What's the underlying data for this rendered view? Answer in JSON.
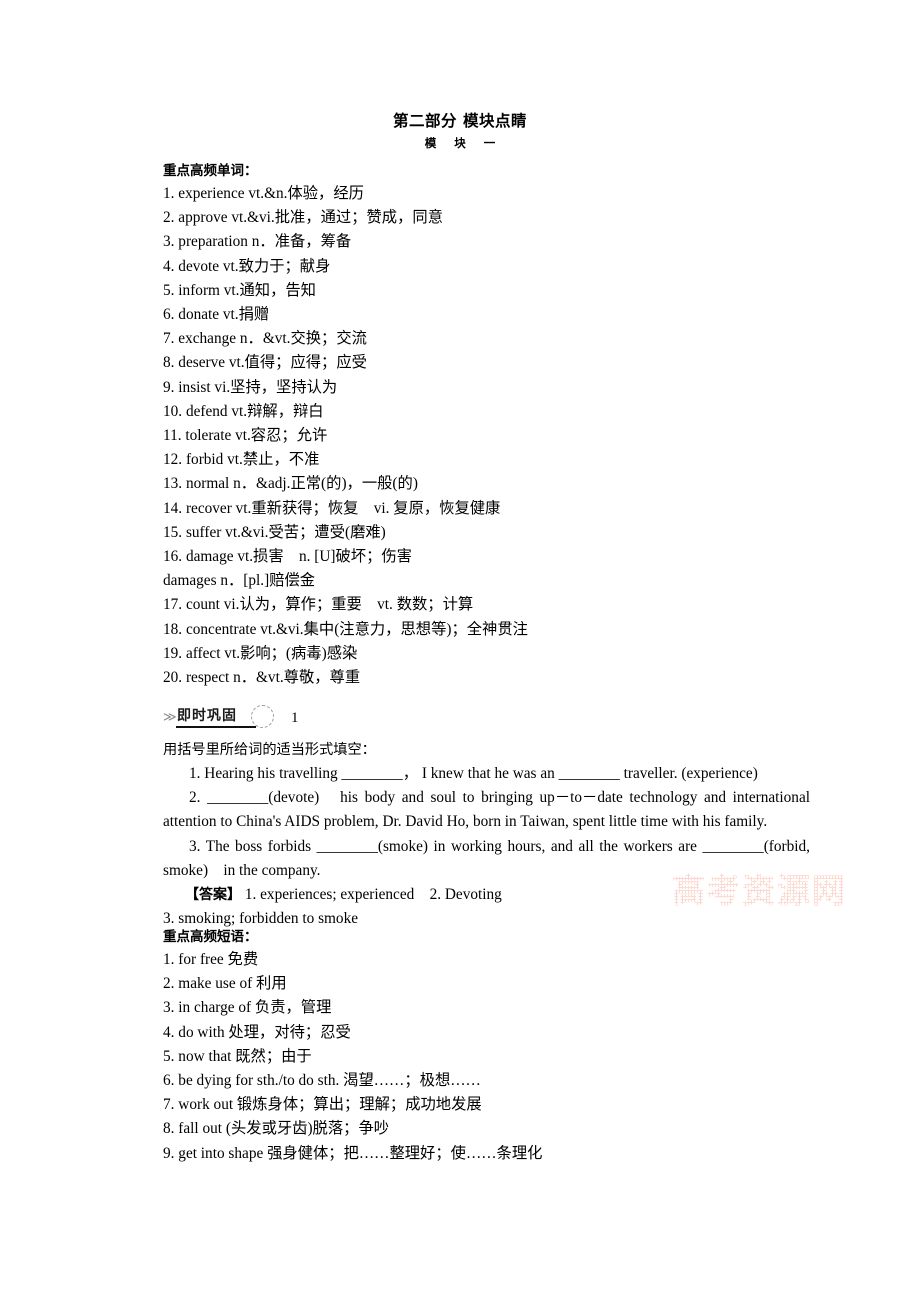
{
  "header": {
    "title": "第二部分  模块点睛",
    "subtitle": "模  块  一"
  },
  "words_section": {
    "heading": "重点高频单词：",
    "items": [
      "1. experience vt.&n.体验，经历",
      "2. approve vt.&vi.批准，通过；赞成，同意",
      "3. preparation n．准备，筹备",
      "4. devote vt.致力于；献身",
      "5. inform vt.通知，告知",
      "6. donate vt.捐赠",
      "7. exchange n．&vt.交换；交流",
      "8. deserve vt.值得；应得；应受",
      "9. insist vi.坚持，坚持认为",
      "10. defend vt.辩解，辩白",
      "11. tolerate vt.容忍；允许",
      "12. forbid vt.禁止，不准",
      "13. normal n．&adj.正常(的)，一般(的)",
      "14. recover vt.重新获得；恢复　vi. 复原，恢复健康",
      "15. suffer vt.&vi.受苦；遭受(磨难)",
      "16. damage vt.损害　n. [U]破坏；伤害",
      "damages n．[pl.]赔偿金",
      "17. count vi.认为，算作；重要　vt. 数数；计算",
      "18. concentrate vt.&vi.集中(注意力，思想等)；全神贯注",
      "19. affect vt.影响；(病毒)感染",
      "20. respect n．&vt.尊敬，尊重"
    ]
  },
  "practice": {
    "badge_chevron": "≫",
    "badge_label": "即时巩固",
    "badge_number": "1",
    "prompt": "用括号里所给词的适当形式填空：",
    "q1": "1. Hearing his travelling ________， I knew that he was an ________ traveller. (experience)",
    "q2": "2. ________(devote)　his body and soul to bringing up－to－date technology and international attention to China's AIDS problem, Dr. David Ho, born in Taiwan, spent little time with his family.",
    "q3": "3. The boss forbids ________(smoke) in working hours, and all the workers are ________(forbid, smoke)　in the company.",
    "answer_label": "【答案】",
    "answer_line1": "1. experiences; experienced　2. Devoting",
    "answer_line2": "3. smoking; forbidden to smoke"
  },
  "phrases_section": {
    "heading": "重点高频短语：",
    "items": [
      "1. for free 免费",
      "2. make use of 利用",
      "3. in charge of 负责，管理",
      "4. do with 处理，对待；忍受",
      "5. now that 既然；由于",
      "6. be dying for sth./to do sth. 渴望……；极想……",
      "7. work out 锻炼身体；算出；理解；成功地发展",
      "8. fall out (头发或牙齿)脱落；争吵",
      "9. get into shape 强身健体；把……整理好；使……条理化"
    ]
  },
  "watermark": {
    "text": "高考资源网",
    "color": "#f7c9d6"
  }
}
